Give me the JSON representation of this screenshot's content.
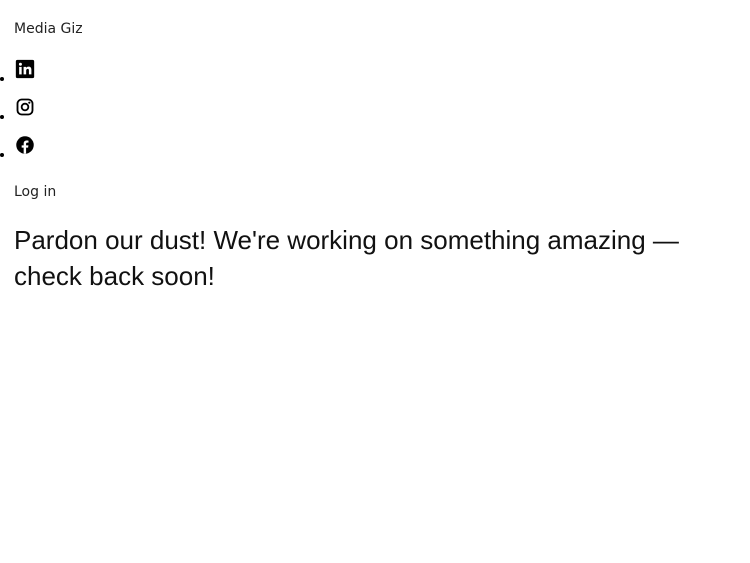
{
  "header": {
    "site_title": "Media Giz"
  },
  "social": [
    {
      "icon": "linkedin-icon",
      "label": "LinkedIn"
    },
    {
      "icon": "instagram-icon",
      "label": "Instagram"
    },
    {
      "icon": "facebook-icon",
      "label": "Facebook"
    }
  ],
  "account": {
    "login_label": "Log in"
  },
  "main": {
    "message": "Pardon our dust! We're working on something amazing — check back soon!"
  },
  "colors": {
    "text": "#111111",
    "background": "#ffffff"
  }
}
